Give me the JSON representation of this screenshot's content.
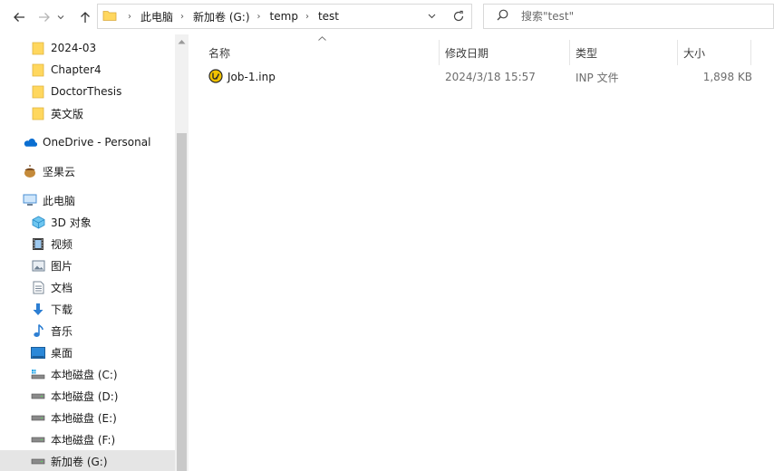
{
  "address": {
    "crumbs": [
      "此电脑",
      "新加卷 (G:)",
      "temp",
      "test"
    ]
  },
  "search": {
    "placeholder": "搜索\"test\""
  },
  "sidebar": {
    "items": [
      {
        "label": "2024-03",
        "icon": "folder-icon"
      },
      {
        "label": "Chapter4",
        "icon": "folder-icon"
      },
      {
        "label": "DoctorThesis",
        "icon": "folder-icon"
      },
      {
        "label": "英文版",
        "icon": "folder-icon"
      },
      {
        "label": "OneDrive - Personal",
        "icon": "onedrive-cloud-icon"
      },
      {
        "label": "坚果云",
        "icon": "jianguoyun-icon"
      },
      {
        "label": "此电脑",
        "icon": "this-pc-icon"
      },
      {
        "label": "3D 对象",
        "icon": "3d-objects-icon"
      },
      {
        "label": "视频",
        "icon": "video-icon"
      },
      {
        "label": "图片",
        "icon": "pictures-icon"
      },
      {
        "label": "文档",
        "icon": "documents-icon"
      },
      {
        "label": "下载",
        "icon": "download-icon"
      },
      {
        "label": "音乐",
        "icon": "music-icon"
      },
      {
        "label": "桌面",
        "icon": "desktop-icon"
      },
      {
        "label": "本地磁盘 (C:)",
        "icon": "system-drive-icon"
      },
      {
        "label": "本地磁盘 (D:)",
        "icon": "drive-icon"
      },
      {
        "label": "本地磁盘 (E:)",
        "icon": "drive-icon"
      },
      {
        "label": "本地磁盘 (F:)",
        "icon": "drive-icon"
      },
      {
        "label": "新加卷 (G:)",
        "icon": "drive-icon"
      }
    ]
  },
  "columns": {
    "name": "名称",
    "date": "修改日期",
    "type": "类型",
    "size": "大小"
  },
  "files": [
    {
      "name": "Job-1.inp",
      "date": "2024/3/18 15:57",
      "type": "INP 文件",
      "size": "1,898 KB",
      "icon": "inp-file-icon"
    }
  ],
  "colors": {
    "folder": "#ffd75e",
    "accent": "#0078d4",
    "selected_bg": "#e5e5e5"
  }
}
